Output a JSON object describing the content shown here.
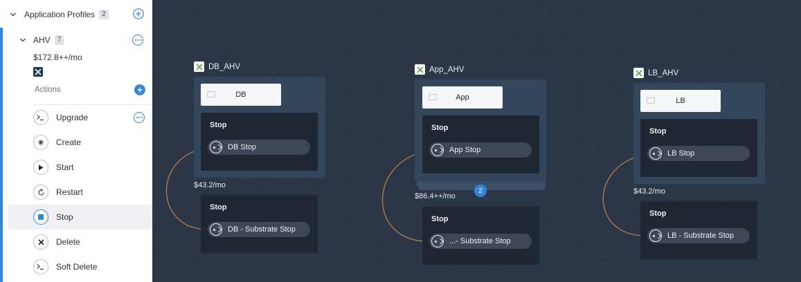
{
  "sidebar": {
    "profiles_label": "Application Profiles",
    "profiles_count": "2",
    "profile_name": "AHV",
    "profile_count": "7",
    "profile_cost": "$172.8++/mo",
    "actions_label": "Actions",
    "actions": [
      {
        "label": "Upgrade",
        "icon": "terminal-icon"
      },
      {
        "label": "Create",
        "icon": "create-icon"
      },
      {
        "label": "Start",
        "icon": "play-icon"
      },
      {
        "label": "Restart",
        "icon": "restart-icon"
      },
      {
        "label": "Stop",
        "icon": "stop-icon"
      },
      {
        "label": "Delete",
        "icon": "delete-icon"
      },
      {
        "label": "Soft Delete",
        "icon": "terminal-icon"
      }
    ],
    "selected_action": "Stop"
  },
  "canvas": {
    "colors": {
      "arrow": "#d98a3d",
      "accent": "#2e86de"
    },
    "deployments": [
      {
        "name": "DB_AHV",
        "service": "DB",
        "task_title": "Stop",
        "task": "DB Stop",
        "cost": "$43.2/mo",
        "substrate_title": "Stop",
        "substrate_task": "DB - Substrate Stop"
      },
      {
        "name": "App_AHV",
        "service": "App",
        "task_title": "Stop",
        "task": "App Stop",
        "cost": "$86.4++/mo",
        "replicas": "2",
        "substrate_title": "Stop",
        "substrate_task": "...- Substrate Stop"
      },
      {
        "name": "LB_AHV",
        "service": "LB",
        "task_title": "Stop",
        "task": "LB Stop",
        "cost": "$43.2/mo",
        "substrate_title": "Stop",
        "substrate_task": "LB - Substrate Stop"
      }
    ]
  }
}
